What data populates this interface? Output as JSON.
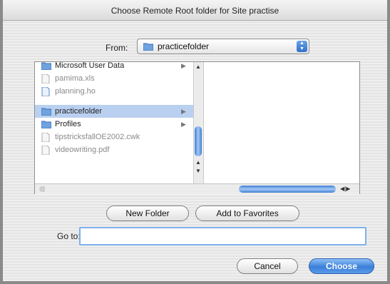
{
  "window": {
    "title": "Choose Remote Root folder for Site practise"
  },
  "from": {
    "label": "From:",
    "selected": "practicefolder"
  },
  "browser": {
    "items": [
      {
        "label": "Microsoft User Data",
        "icon": "folder-icon",
        "kind": "folder"
      },
      {
        "label": "pamima.xls",
        "icon": "document-icon",
        "kind": "file"
      },
      {
        "label": "planning.ho",
        "icon": "document-icon",
        "kind": "file"
      },
      {
        "label": "practicefolder",
        "icon": "folder-icon",
        "kind": "folder",
        "selected": true
      },
      {
        "label": "Profiles",
        "icon": "folder-icon",
        "kind": "folder"
      },
      {
        "label": "tipstricksfallOE2002.cwk",
        "icon": "document-icon",
        "kind": "file"
      },
      {
        "label": "videowriting.pdf",
        "icon": "document-icon",
        "kind": "file"
      }
    ]
  },
  "buttons": {
    "new_folder": "New Folder",
    "add_favorites": "Add to Favorites",
    "cancel": "Cancel",
    "choose": "Choose"
  },
  "goto": {
    "label": "Go to:",
    "value": ""
  },
  "colors": {
    "selection": "#b9d0f0",
    "accent": "#3b7fd8"
  }
}
